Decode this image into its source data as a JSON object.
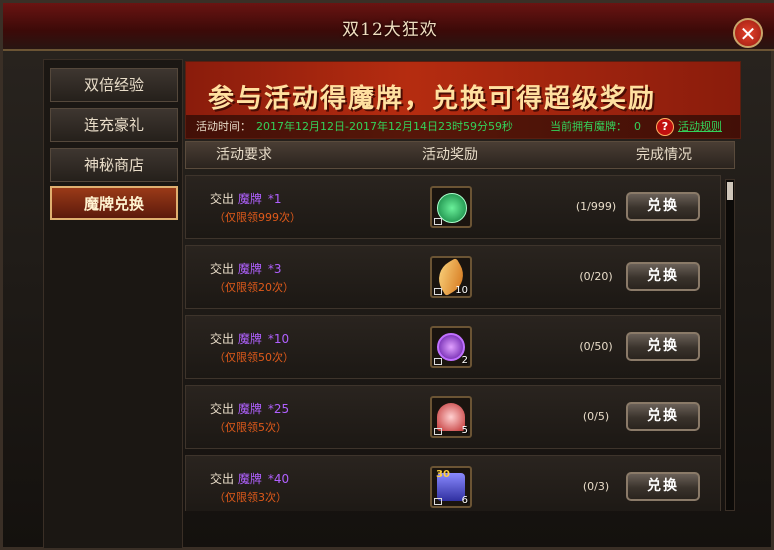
{
  "window": {
    "title": "双12大狂欢",
    "close_glyph": "✕"
  },
  "sidebar": {
    "items": [
      {
        "label": "双倍经验",
        "active": false
      },
      {
        "label": "连充豪礼",
        "active": false
      },
      {
        "label": "神秘商店",
        "active": false
      },
      {
        "label": "魔牌兑换",
        "active": true
      }
    ]
  },
  "banner": {
    "slogan": "参与活动得魔牌，兑换可得超级奖励",
    "time_label": "活动时间：",
    "time_value": "2017年12月12日-2017年12月14日23时59分59秒",
    "owned_label": "当前拥有魔牌：",
    "owned_value": "0",
    "help_glyph": "?",
    "rules_link": "活动规则"
  },
  "table": {
    "headers": [
      "活动要求",
      "活动奖励",
      "完成情况"
    ],
    "rows": [
      {
        "hand_in": "交出",
        "card": "魔牌",
        "qty": "*1",
        "limit": "（仅限领999次）",
        "reward_icon": "exp-orb-green-icon",
        "reward_count": "",
        "progress": "(1/999)",
        "button": "兑换"
      },
      {
        "hand_in": "交出",
        "card": "魔牌",
        "qty": "*3",
        "limit": "（仅限领20次）",
        "reward_icon": "golden-feather-icon",
        "reward_count": "10",
        "progress": "(0/20)",
        "button": "兑换"
      },
      {
        "hand_in": "交出",
        "card": "魔牌",
        "qty": "*10",
        "limit": "（仅限领50次）",
        "reward_icon": "exp-orb-purple-icon",
        "reward_count": "2",
        "progress": "(0/50)",
        "button": "兑换"
      },
      {
        "hand_in": "交出",
        "card": "魔牌",
        "qty": "*25",
        "limit": "（仅限领5次）",
        "reward_icon": "lotus-flower-icon",
        "reward_count": "5",
        "progress": "(0/5)",
        "button": "兑换"
      },
      {
        "hand_in": "交出",
        "card": "魔牌",
        "qty": "*40",
        "limit": "（仅限领3次）",
        "reward_icon": "star-scroll-icon",
        "reward_count": "6",
        "progress": "(0/3)",
        "button": "兑换",
        "reward_badge": "30"
      }
    ]
  },
  "colors": {
    "accent_red": "#b52c10",
    "card_purple": "#b060ff",
    "limit_orange": "#e05a1a",
    "info_green": "#34d15a"
  }
}
